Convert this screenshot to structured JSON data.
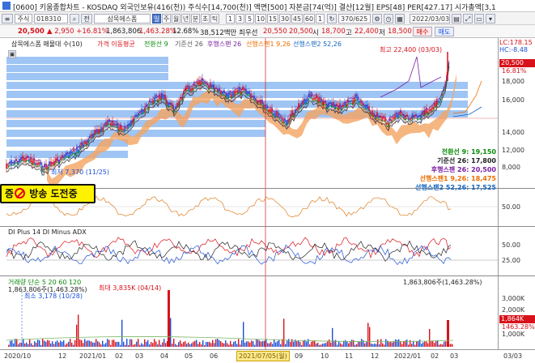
{
  "window": {
    "title": "[0600] 키움종합차트 - KOSDAQ 외국인보유(416(천)) 주식수[14,700(천)] 액면[500] 자본금[74(억)] 결산[12월] EPS[48] PER[427.17] 시가총액[3,1"
  },
  "toolbar": {
    "code_prefix": "주식",
    "code": "018310",
    "name": "삼목에스폼",
    "period_buttons": [
      "일",
      "주",
      "월",
      "년",
      "분",
      "초",
      "틱"
    ],
    "interval_buttons": [
      "1",
      "3",
      "5",
      "10",
      "15",
      "30",
      "45",
      "60",
      "1"
    ],
    "count": "370/625",
    "date": "2022/03/03",
    "icon_names": [
      "search-icon",
      "refresh-icon",
      "settings-icon"
    ]
  },
  "quote": {
    "price": "20,500",
    "change": "▲ 2,950 +16.81%",
    "volume": "1,863,806",
    "volume_ratio": "1,463.28%",
    "turnover_ratio": "12.68%",
    "amount": "38,512백만",
    "best_bid_label": "최우선",
    "bid": "20,550",
    "ask": "20,500",
    "open_label": "시",
    "open": "18,700",
    "high_label": "고",
    "high": "22,400",
    "low_label": "저",
    "low": "18,500",
    "buy_button": "매수",
    "sell_button": "매도"
  },
  "price_panel": {
    "title": "삼목에스폼 매물대 수(10)",
    "ma_label": "가격 이동평균",
    "ichimoku_labels": [
      "전환선 9",
      "기준선 26",
      "후행스팬 26",
      "선행스팬1 9,26",
      "선행스팬2 52,26"
    ],
    "lc": "LC:178.15",
    "hc": "HC:-8.48",
    "max_label": "최고 22,400 (03/03)",
    "min_label": "최저 7,370 (11/25)",
    "y_ticks": [
      "18,000",
      "16,000",
      "14,000",
      "12,000",
      "10,000",
      "8,000"
    ],
    "price_tag": "20,500",
    "price_tag_pct": "16.81%",
    "legend": [
      {
        "label": "전환선 9: 19,150",
        "color": "#0a8a0a"
      },
      {
        "label": "기준선 26: 17,800",
        "color": "#222222"
      },
      {
        "label": "후행스팬 26: 20,500",
        "color": "#7b1fa2"
      },
      {
        "label": "선행스팬1 9,26: 18,475",
        "color": "#ef6c00"
      },
      {
        "label": "선행스팬2 52,26: 17,525",
        "color": "#1565c0"
      }
    ]
  },
  "osc_panel": {
    "tick": "50.00"
  },
  "dmi_panel": {
    "title": "DI Plus 14  DI Minus  ADX",
    "ticks": [
      "50.00",
      "25.00"
    ]
  },
  "volume_panel": {
    "title": "거래량  단순 5  20  60  120",
    "cur_label": "1,863,806주(1,463.28%)",
    "cur_label_right": "1,863,806주(1,463.28%)",
    "max_label": "최대 3,835K (04/14)",
    "min_label": "최소 3,178 (10/28)",
    "ticks": [
      "3,000K",
      "2,000K",
      "1,000K"
    ],
    "tag1": "1,864K",
    "tag2": "1463.28%"
  },
  "overlay": {
    "sticker_text": "방송 도전중",
    "sticker_prefix": "증"
  },
  "x_axis": {
    "labels": [
      "2020/10",
      "12",
      "2021/01",
      "02",
      "03",
      "04",
      "05",
      "06",
      "2021/07/05(월)",
      "09",
      "10",
      "11",
      "12",
      "2022/01",
      "02",
      "03",
      "03/03"
    ]
  },
  "colors": {
    "up": "#d8121b",
    "down": "#1a4fd6",
    "volume_profile": "#7fb2f0",
    "cloud": "#f4a460"
  }
}
